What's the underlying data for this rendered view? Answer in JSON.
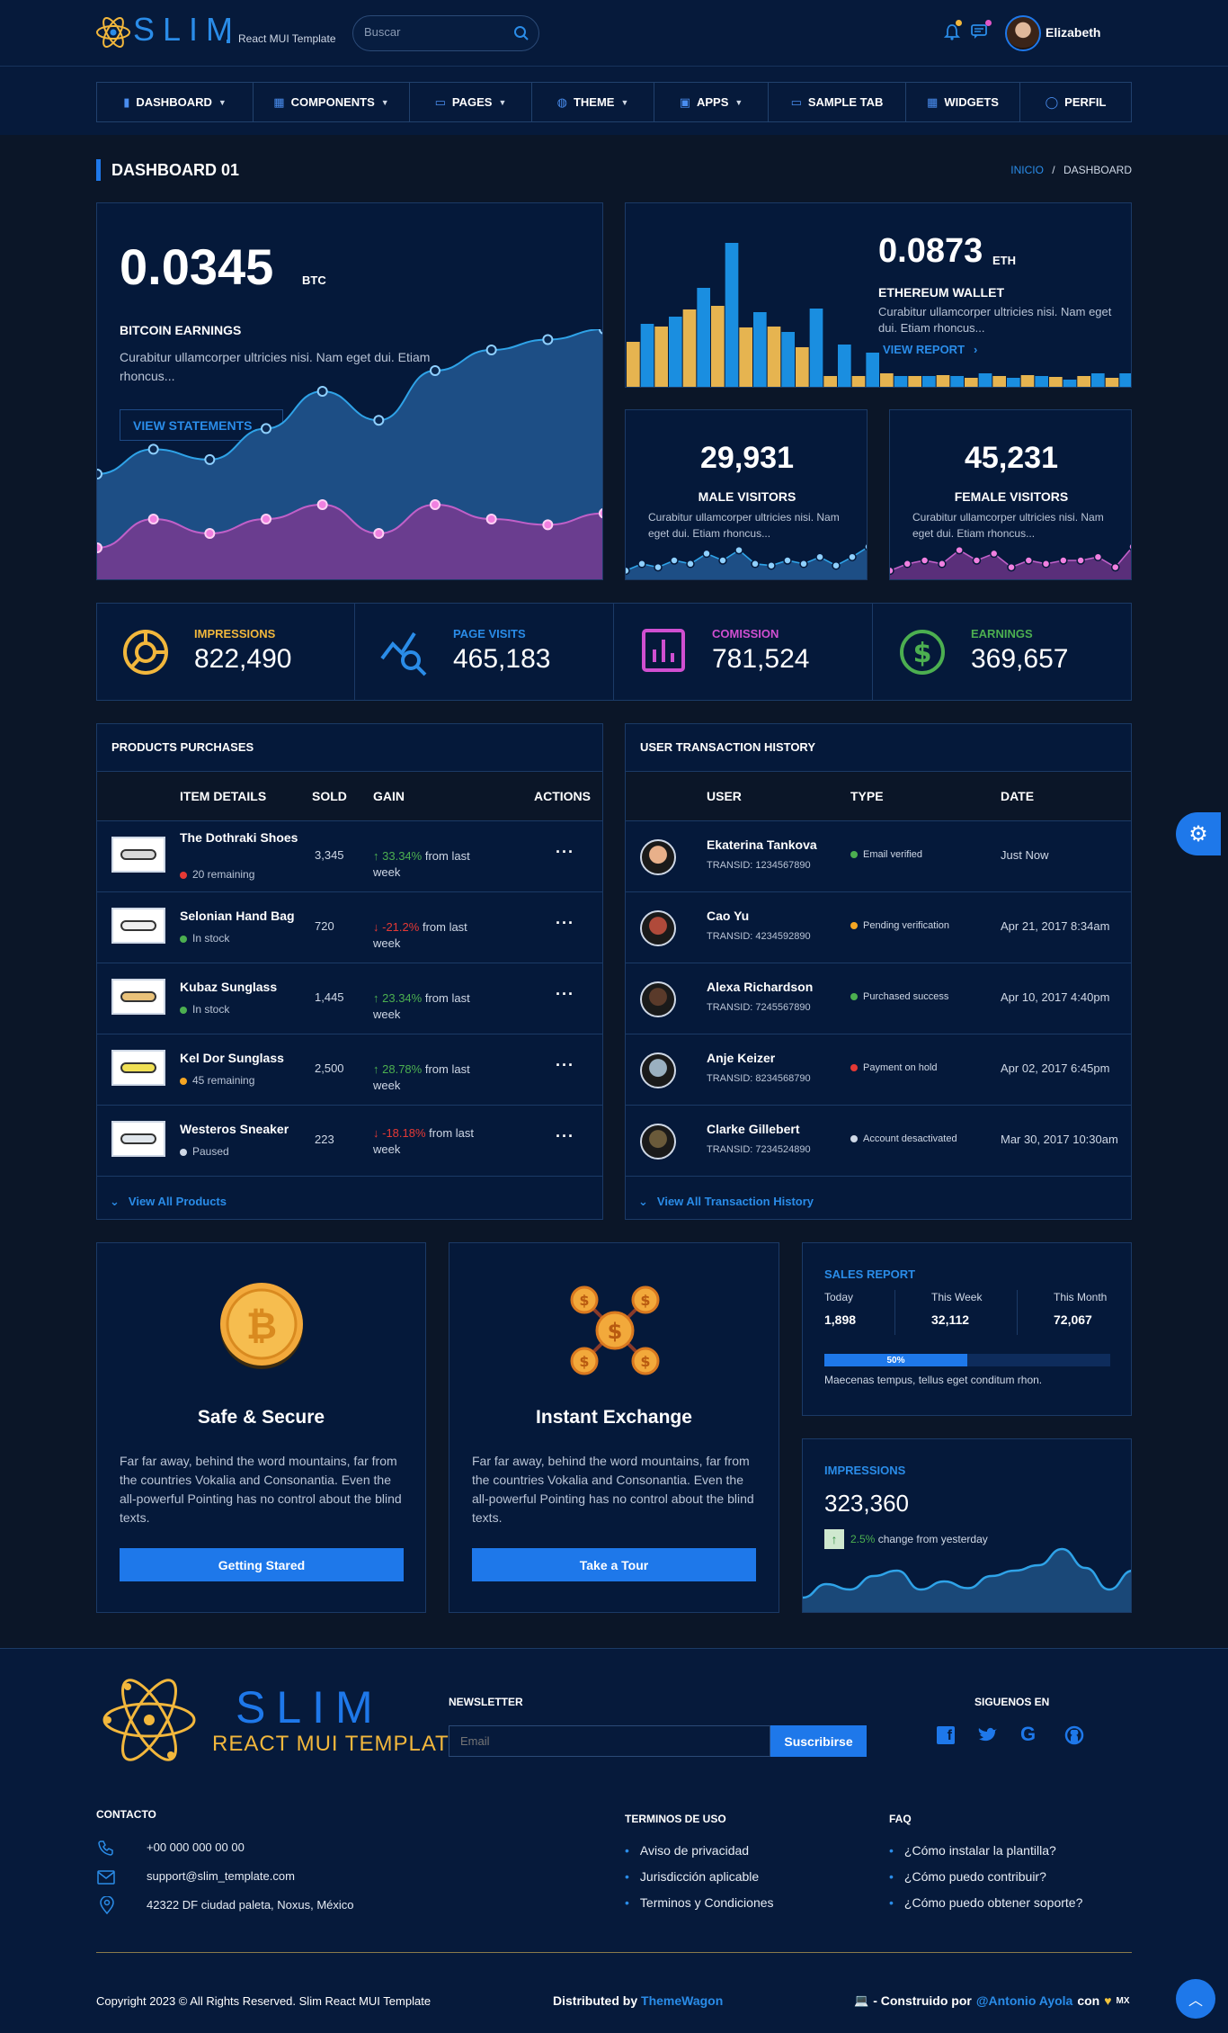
{
  "header": {
    "logo_text": "SLIM",
    "logo_sub": "React MUI Template",
    "search_placeholder": "Buscar",
    "user_name": "Elizabeth",
    "colors": {
      "accent": "#1e78ea",
      "bg": "#0b1628",
      "panel": "#05193a"
    }
  },
  "nav": [
    {
      "label": "DASHBOARD",
      "icon": "bar-chart-icon",
      "dropdown": true
    },
    {
      "label": "COMPONENTS",
      "icon": "grid-icon",
      "dropdown": true
    },
    {
      "label": "PAGES",
      "icon": "book-icon",
      "dropdown": true
    },
    {
      "label": "THEME",
      "icon": "palette-icon",
      "dropdown": true
    },
    {
      "label": "APPS",
      "icon": "apps-icon",
      "dropdown": true
    },
    {
      "label": "SAMPLE TAB",
      "icon": "tab-icon",
      "dropdown": false
    },
    {
      "label": "WIDGETS",
      "icon": "widgets-icon",
      "dropdown": false
    },
    {
      "label": "PERFIL",
      "icon": "user-icon",
      "dropdown": false
    }
  ],
  "page": {
    "title": "DASHBOARD 01",
    "crumb_home": "INICIO",
    "crumb_sep": "/",
    "crumb_current": "DASHBOARD"
  },
  "bitcoin": {
    "value": "0.0345",
    "unit": "BTC",
    "title": "BITCOIN EARNINGS",
    "desc": "Curabitur ullamcorper ultricies nisi. Nam eget dui. Etiam rhoncus...",
    "button": "VIEW STATEMENTS",
    "chart_data": {
      "type": "area",
      "x": [
        1,
        2,
        3,
        4,
        5,
        6,
        7,
        8,
        9,
        10
      ],
      "series": [
        {
          "values": [
            30,
            42,
            37,
            52,
            70,
            56,
            80,
            90,
            95,
            100
          ],
          "color": "#2fa3e8"
        },
        {
          "values": [
            10,
            20,
            15,
            20,
            25,
            15,
            25,
            20,
            18,
            22
          ],
          "color": "#c060c8"
        }
      ]
    }
  },
  "ethereum": {
    "value": "0.0873",
    "unit": "ETH",
    "title": "ETHEREUM WALLET",
    "desc": "Curabitur ullamcorper ultricies nisi. Nam eget dui. Etiam rhoncus...",
    "link": "VIEW REPORT",
    "chart_data": {
      "type": "bar",
      "series": [
        {
          "values": [
            50,
            67,
            86,
            90,
            66,
            67,
            44,
            12,
            12,
            15,
            12,
            13,
            10,
            12,
            13,
            11,
            12,
            10
          ],
          "color": "#e6b450"
        },
        {
          "values": [
            70,
            78,
            110,
            160,
            83,
            61,
            87,
            47,
            38,
            12,
            12,
            12,
            15,
            10,
            12,
            8,
            15,
            15
          ],
          "color": "#1a8ee0"
        }
      ]
    }
  },
  "male": {
    "value": "29,931",
    "title": "MALE VISITORS",
    "desc": "Curabitur ullamcorper ultricies nisi. Nam eget dui. Etiam rhoncus...",
    "chart_data": {
      "type": "area",
      "values": [
        4,
        8,
        6,
        10,
        8,
        14,
        10,
        16,
        8,
        7,
        10,
        8,
        12,
        7,
        12,
        18
      ]
    }
  },
  "female": {
    "value": "45,231",
    "title": "FEMALE VISITORS",
    "desc": "Curabitur ullamcorper ultricies nisi. Nam eget dui. Etiam rhoncus...",
    "chart_data": {
      "type": "area",
      "values": [
        4,
        8,
        10,
        8,
        16,
        10,
        14,
        6,
        10,
        8,
        10,
        10,
        12,
        6,
        18
      ]
    }
  },
  "stats": [
    {
      "label": "IMPRESSIONS",
      "value": "822,490",
      "color": "#f2b73c",
      "icon": "pie-chart-icon"
    },
    {
      "label": "PAGE VISITS",
      "value": "465,183",
      "color": "#2a8ce8",
      "icon": "analytics-search-icon"
    },
    {
      "label": "COMISSION",
      "value": "781,524",
      "color": "#d04fd0",
      "icon": "bar-chart-box-icon"
    },
    {
      "label": "EARNINGS",
      "value": "369,657",
      "color": "#4caf50",
      "icon": "dollar-icon"
    }
  ],
  "products": {
    "title": "PRODUCTS PURCHASES",
    "columns": [
      "ITEM DETAILS",
      "SOLD",
      "GAIN",
      "ACTIONS"
    ],
    "rows": [
      {
        "name": "The Dothraki Shoes",
        "status": "20 remaining",
        "status_color": "#e53935",
        "sold": "3,345",
        "gain": "33.34%",
        "up": true,
        "suffix": "from last week"
      },
      {
        "name": "Selonian Hand Bag",
        "status": "In stock",
        "status_color": "#4caf50",
        "sold": "720",
        "gain": "-21.2%",
        "up": false,
        "suffix": "from last week"
      },
      {
        "name": "Kubaz Sunglass",
        "status": "In stock",
        "status_color": "#4caf50",
        "sold": "1,445",
        "gain": "23.34%",
        "up": true,
        "suffix": "from last week"
      },
      {
        "name": "Kel Dor Sunglass",
        "status": "45 remaining",
        "status_color": "#f5a623",
        "sold": "2,500",
        "gain": "28.78%",
        "up": true,
        "suffix": "from last week"
      },
      {
        "name": "Westeros Sneaker",
        "status": "Paused",
        "status_color": "#cfd8e6",
        "sold": "223",
        "gain": "-18.18%",
        "up": false,
        "suffix": "from last week"
      }
    ],
    "footer": "View All Products"
  },
  "transactions": {
    "title": "USER TRANSACTION HISTORY",
    "columns": [
      "USER",
      "TYPE",
      "DATE"
    ],
    "rows": [
      {
        "name": "Ekaterina Tankova",
        "id": "TRANSID: 1234567890",
        "type": "Email verified",
        "color": "#4caf50",
        "date": "Just Now"
      },
      {
        "name": "Cao Yu",
        "id": "TRANSID: 4234592890",
        "type": "Pending verification",
        "color": "#f5a623",
        "date": "Apr 21, 2017 8:34am"
      },
      {
        "name": "Alexa Richardson",
        "id": "TRANSID: 7245567890",
        "type": "Purchased success",
        "color": "#4caf50",
        "date": "Apr 10, 2017 4:40pm"
      },
      {
        "name": "Anje Keizer",
        "id": "TRANSID: 8234568790",
        "type": "Payment on hold",
        "color": "#e53935",
        "date": "Apr 02, 2017 6:45pm"
      },
      {
        "name": "Clarke Gillebert",
        "id": "TRANSID: 7234524890",
        "type": "Account desactivated",
        "color": "#cfd8e6",
        "date": "Mar 30, 2017 10:30am"
      }
    ],
    "footer": "View All Transaction History"
  },
  "safe": {
    "title": "Safe & Secure",
    "desc": "Far far away, behind the word mountains, far from the countries Vokalia and Consonantia. Even the all-powerful Pointing has no control about the blind texts.",
    "button": "Getting Stared"
  },
  "exchange": {
    "title": "Instant Exchange",
    "desc": "Far far away, behind the word mountains, far from the countries Vokalia and Consonantia. Even the all-powerful Pointing has no control about the blind texts.",
    "button": "Take a Tour"
  },
  "sales": {
    "title": "SALES REPORT",
    "cols": [
      {
        "label": "Today",
        "value": "1,898"
      },
      {
        "label": "This Week",
        "value": "32,112"
      },
      {
        "label": "This Month",
        "value": "72,067"
      }
    ],
    "progress": 0.5,
    "progress_label": "50%",
    "note": "Maecenas tempus, tellus eget conditum rhon."
  },
  "impressions2": {
    "title": "IMPRESSIONS",
    "value": "323,360",
    "change": "2.5%",
    "change_suffix": "change from yesterday",
    "chart_data": {
      "type": "area",
      "values": [
        8,
        18,
        14,
        24,
        28,
        14,
        20,
        15,
        24,
        28,
        32,
        44,
        30,
        14,
        28
      ]
    }
  },
  "footer": {
    "logo_text": "SLIM",
    "logo_sub": "REACT MUI TEMPLATE",
    "newsletter_title": "NEWSLETTER",
    "email_placeholder": "Email",
    "subscribe": "Suscribirse",
    "social_title": "SIGUENOS EN",
    "social": [
      "facebook-icon",
      "twitter-icon",
      "google-icon",
      "github-icon"
    ],
    "contact_title": "CONTACTO",
    "contact": [
      {
        "icon": "phone-icon",
        "text": "+00 000 000 00 00"
      },
      {
        "icon": "mail-icon",
        "text": "support@slim_template.com"
      },
      {
        "icon": "location-icon",
        "text": "42322 DF ciudad paleta, Noxus, México"
      }
    ],
    "terms_title": "TERMINOS DE USO",
    "terms": [
      "Aviso de privacidad",
      "Jurisdicción aplicable",
      "Terminos y Condiciones"
    ],
    "faq_title": "FAQ",
    "faq": [
      "¿Cómo instalar la plantilla?",
      "¿Cómo puedo contribuir?",
      "¿Cómo puedo obtener soporte?"
    ],
    "copyright": "Copyright 2023 © All Rights Reserved. Slim React MUI Template",
    "distributed": "Distributed by",
    "distributed_link": "ThemeWagon",
    "built": "- Construido por",
    "built_link": "@Antonio Ayola",
    "built_con": "con",
    "built_mx": "MX"
  }
}
